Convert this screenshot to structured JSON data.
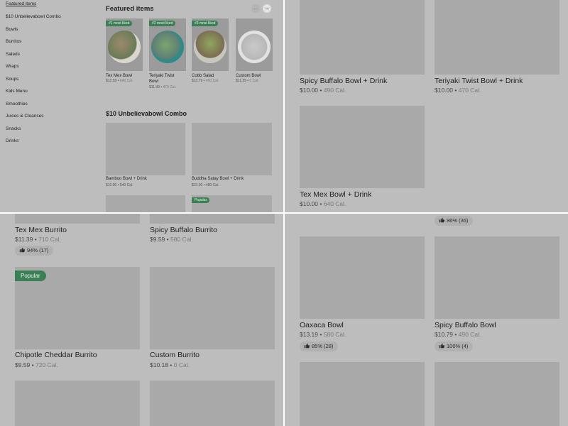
{
  "sidebar": {
    "items": [
      {
        "label": "Featured items",
        "active": true
      },
      {
        "label": "$10 Unbelievabowl Combo",
        "active": false
      },
      {
        "label": "Bowls",
        "active": false
      },
      {
        "label": "Burritos",
        "active": false
      },
      {
        "label": "Salads",
        "active": false
      },
      {
        "label": "Wraps",
        "active": false
      },
      {
        "label": "Soups",
        "active": false
      },
      {
        "label": "Kids Menu",
        "active": false
      },
      {
        "label": "Smoothies",
        "active": false
      },
      {
        "label": "Juices & Cleanses",
        "active": false
      },
      {
        "label": "Snacks",
        "active": false
      },
      {
        "label": "Drinks",
        "active": false
      }
    ]
  },
  "featured": {
    "title": "Featured items",
    "prev_symbol": "←",
    "next_symbol": "→",
    "items": [
      {
        "badge": "#1 most liked",
        "name": "Tex Mex Bowl",
        "price": "$12.59",
        "cal": "640 Cal."
      },
      {
        "badge": "#2 most liked",
        "name": "Teriyaki Twist Bowl",
        "price": "$11.99",
        "cal": "470 Cal."
      },
      {
        "badge": "#3 most liked",
        "name": "Cobb Salad",
        "price": "$13.79",
        "cal": "450 Cal."
      },
      {
        "badge": "",
        "name": "Custom Bowl",
        "price": "$11.39",
        "cal": "0 Cal."
      }
    ]
  },
  "combo_section": {
    "title": "$10 Unbelievabowl Combo",
    "items": [
      {
        "name": "Bamboo Bowl + Drink",
        "price": "$10.00",
        "cal": "540 Cal."
      },
      {
        "name": "Buddha Satay Bowl + Drink",
        "price": "$10.00",
        "cal": "480 Cal."
      }
    ],
    "popular_badge": "Popular"
  },
  "panel_combo": {
    "items": [
      {
        "name": "Spicy Buffalo Bowl + Drink",
        "price": "$10.00",
        "cal": "490 Cal."
      },
      {
        "name": "Teriyaki Twist Bowl + Drink",
        "price": "$10.00",
        "cal": "470 Cal."
      },
      {
        "name": "Tex Mex Bowl + Drink",
        "price": "$10.00",
        "cal": "640 Cal."
      }
    ]
  },
  "panel_burritos": {
    "items": [
      {
        "name": "Tex Mex Burrito",
        "price": "$11.39",
        "cal": "710 Cal.",
        "rating": "94% (17)"
      },
      {
        "name": "Spicy Buffalo Burrito",
        "price": "$9.59",
        "cal": "580 Cal."
      },
      {
        "name": "Chipotle Cheddar Burrito",
        "price": "$9.59",
        "cal": "720 Cal."
      },
      {
        "name": "Custom Burrito",
        "price": "$10.18",
        "cal": "0 Cal."
      }
    ],
    "popular_badge": "Popular"
  },
  "panel_bowls": {
    "top_rating": "86% (36)",
    "items": [
      {
        "name": "Oaxaca Bowl",
        "price": "$13.19",
        "cal": "580 Cal.",
        "rating": "85% (28)"
      },
      {
        "name": "Spicy Buffalo Bowl",
        "price": "$10.79",
        "cal": "490 Cal.",
        "rating": "100% (4)"
      }
    ]
  },
  "separator": "•",
  "colors": {
    "badge": "#3b7f55",
    "panel": "#bdbdbd",
    "placeholder": "#a9a9a9"
  }
}
